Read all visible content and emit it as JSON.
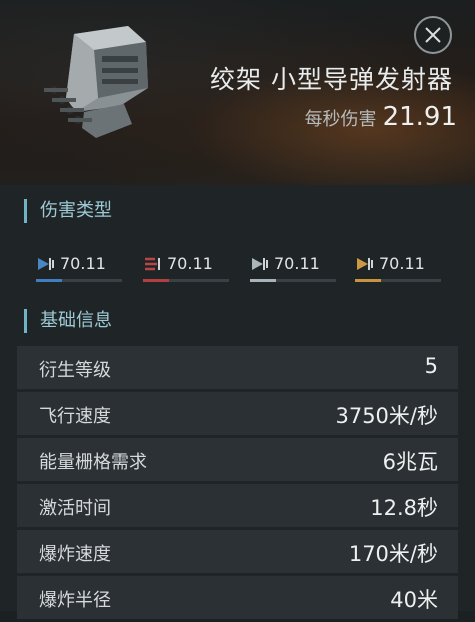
{
  "header": {
    "title": "绞架 小型导弹发射器",
    "dps_label": "每秒伤害",
    "dps_value": "21.91"
  },
  "damage_section": {
    "title": "伤害类型",
    "items": [
      {
        "type": "em-icon",
        "value": "70.11",
        "color": "#3f7fbf",
        "fraction": 0.3
      },
      {
        "type": "thermal-icon",
        "value": "70.11",
        "color": "#b04040",
        "fraction": 0.3
      },
      {
        "type": "kinetic-icon",
        "value": "70.11",
        "color": "#a7b3b8",
        "fraction": 0.3
      },
      {
        "type": "explosive-icon",
        "value": "70.11",
        "color": "#c9933f",
        "fraction": 0.3
      }
    ]
  },
  "info_section": {
    "title": "基础信息",
    "rows": [
      {
        "label": "衍生等级",
        "value": "5"
      },
      {
        "label": "飞行速度",
        "value": "3750米/秒"
      },
      {
        "label": "能量栅格需求",
        "value": "6兆瓦"
      },
      {
        "label": "激活时间",
        "value": "12.8秒"
      },
      {
        "label": "爆炸速度",
        "value": "170米/秒"
      },
      {
        "label": "爆炸半径",
        "value": "40米"
      }
    ]
  }
}
